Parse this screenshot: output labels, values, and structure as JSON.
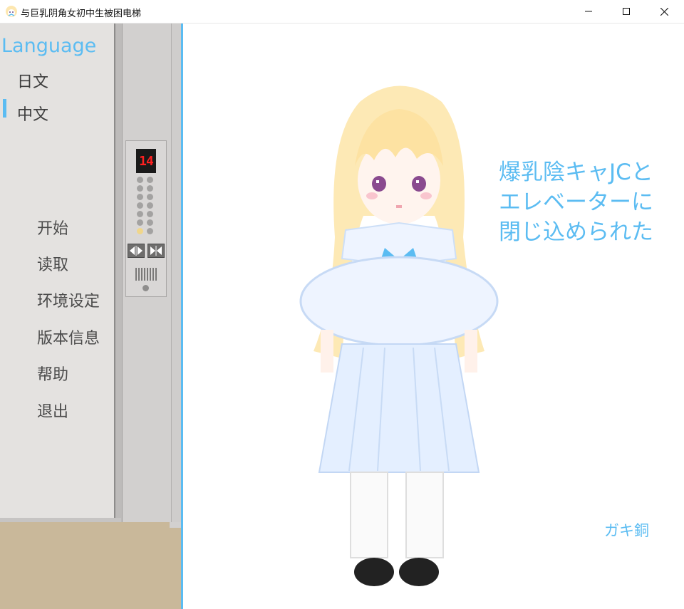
{
  "window": {
    "title": "与巨乳阴角女初中生被困电梯",
    "controls": [
      "minimize",
      "maximize",
      "close"
    ]
  },
  "language_menu": {
    "title": "Language",
    "options": [
      "日文",
      "中文"
    ],
    "selected": "中文"
  },
  "main_menu": {
    "items": [
      "开始",
      "读取",
      "环境设定",
      "版本信息",
      "帮助",
      "退出"
    ]
  },
  "elevator_panel": {
    "floor": "14"
  },
  "game_title": {
    "lines": [
      "爆乳陰キャJCと",
      "エレベーターに",
      "閉じ込められた"
    ]
  },
  "author": "ガキ銅",
  "colors": {
    "accent": "#5bbcf2",
    "menu_text": "#4a4a4a",
    "floor_digits": "#ff2020"
  }
}
